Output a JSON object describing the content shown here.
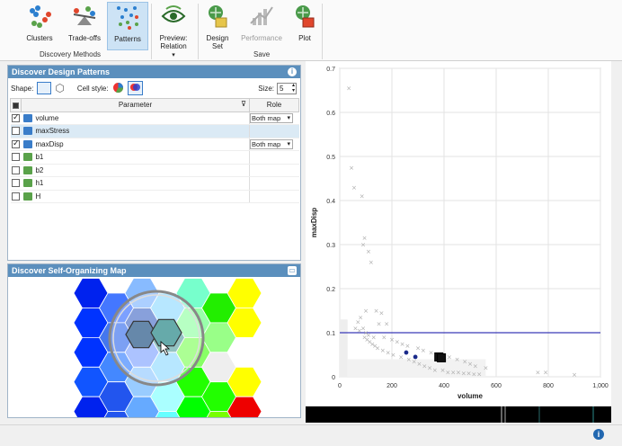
{
  "ribbon": {
    "buttons": [
      {
        "label": "Clusters"
      },
      {
        "label": "Trade-offs"
      },
      {
        "label": "Patterns"
      },
      {
        "label": "Preview:\nRelation"
      },
      {
        "label": "Design\nSet"
      },
      {
        "label": "Performance"
      },
      {
        "label": "Plot"
      }
    ],
    "group_discovery": "Discovery Methods",
    "group_save": "Save"
  },
  "patterns_panel": {
    "title": "Discover Design Patterns",
    "shape_label": "Shape:",
    "cell_style_label": "Cell style:",
    "size_label": "Size:",
    "size_value": "5",
    "columns": {
      "parameter": "Parameter",
      "role": "Role"
    },
    "rows": [
      {
        "name": "volume",
        "checked": true,
        "role": "Both map",
        "type": "output"
      },
      {
        "name": "maxStress",
        "checked": false,
        "role": "",
        "type": "output"
      },
      {
        "name": "maxDisp",
        "checked": true,
        "role": "Both map",
        "type": "output"
      },
      {
        "name": "b1",
        "checked": false,
        "role": "",
        "type": "input"
      },
      {
        "name": "b2",
        "checked": false,
        "role": "",
        "type": "input"
      },
      {
        "name": "h1",
        "checked": false,
        "role": "",
        "type": "input"
      },
      {
        "name": "H",
        "checked": false,
        "role": "",
        "type": "input"
      }
    ]
  },
  "som_panel": {
    "title": "Discover Self-Organizing Map"
  },
  "chart_data": {
    "type": "scatter",
    "xlabel": "volume",
    "ylabel": "maxDisp",
    "xlim": [
      0,
      1000
    ],
    "ylim": [
      0,
      0.7
    ],
    "x_ticks": [
      "0",
      "200",
      "400",
      "600",
      "800",
      "1,000"
    ],
    "y_ticks": [
      "0",
      "0.1",
      "0.2",
      "0.3",
      "0.4",
      "0.5",
      "0.6",
      "0.7"
    ],
    "grid": true,
    "threshold_line_y": 0.1,
    "series": [
      {
        "role": "all designs",
        "color": "#aaaaaa",
        "x": [
          35,
          45,
          55,
          85,
          95,
          90,
          110,
          120,
          100,
          140,
          160,
          80,
          70,
          150,
          180,
          90,
          100,
          110,
          130,
          170,
          200,
          220,
          240,
          260,
          300,
          320,
          350,
          380,
          420,
          450,
          480,
          500,
          520,
          560,
          760,
          790,
          900,
          60,
          75,
          95,
          105,
          115,
          125,
          135,
          145,
          165,
          185,
          205,
          235,
          265,
          285,
          305,
          325,
          345,
          365,
          395,
          415,
          435,
          455,
          475,
          495,
          515,
          535
        ],
        "y": [
          0.655,
          0.475,
          0.43,
          0.41,
          0.315,
          0.3,
          0.285,
          0.26,
          0.15,
          0.15,
          0.145,
          0.135,
          0.125,
          0.12,
          0.12,
          0.11,
          0.1,
          0.095,
          0.09,
          0.09,
          0.085,
          0.08,
          0.075,
          0.07,
          0.065,
          0.06,
          0.055,
          0.05,
          0.045,
          0.04,
          0.035,
          0.03,
          0.025,
          0.02,
          0.01,
          0.01,
          0.005,
          0.11,
          0.105,
          0.09,
          0.085,
          0.08,
          0.075,
          0.07,
          0.065,
          0.06,
          0.055,
          0.05,
          0.045,
          0.04,
          0.035,
          0.03,
          0.025,
          0.02,
          0.015,
          0.015,
          0.01,
          0.01,
          0.01,
          0.008,
          0.008,
          0.006,
          0.006
        ]
      },
      {
        "role": "selected pattern",
        "color": "#1a2a8a",
        "x": [
          255,
          290
        ],
        "y": [
          0.055,
          0.045
        ]
      },
      {
        "role": "selected pattern",
        "color": "#111111",
        "x": [
          380,
          390
        ],
        "y": [
          0.045,
          0.043
        ]
      }
    ]
  },
  "som": {
    "cols": [
      [
        "#0022ee",
        "#0033ff",
        "#0033ff",
        "#1155ff",
        "#0022ee"
      ],
      [
        "#4477ff",
        "#4477ee",
        "#4488ff",
        "#2255ee",
        "#2255ee"
      ],
      [
        "#88bbff",
        "#5577cc",
        "#88aaff",
        "#99ccff",
        "#66aaff"
      ],
      [
        "#99ddff",
        "#66aaaa",
        "#99ddff",
        "#aaffff",
        "#66ffff"
      ],
      [
        "#77ffcc",
        "#99ffaa",
        "#88ff66",
        "#22ff00",
        "#00ff00"
      ],
      [
        "#22ee00",
        "#99ff88",
        "#eeeeee",
        "#22ff00",
        "#77ff00"
      ],
      [
        "#ffff00",
        "#ffff00",
        "#ffffff",
        "#ffff00",
        "#ee0000"
      ]
    ]
  }
}
